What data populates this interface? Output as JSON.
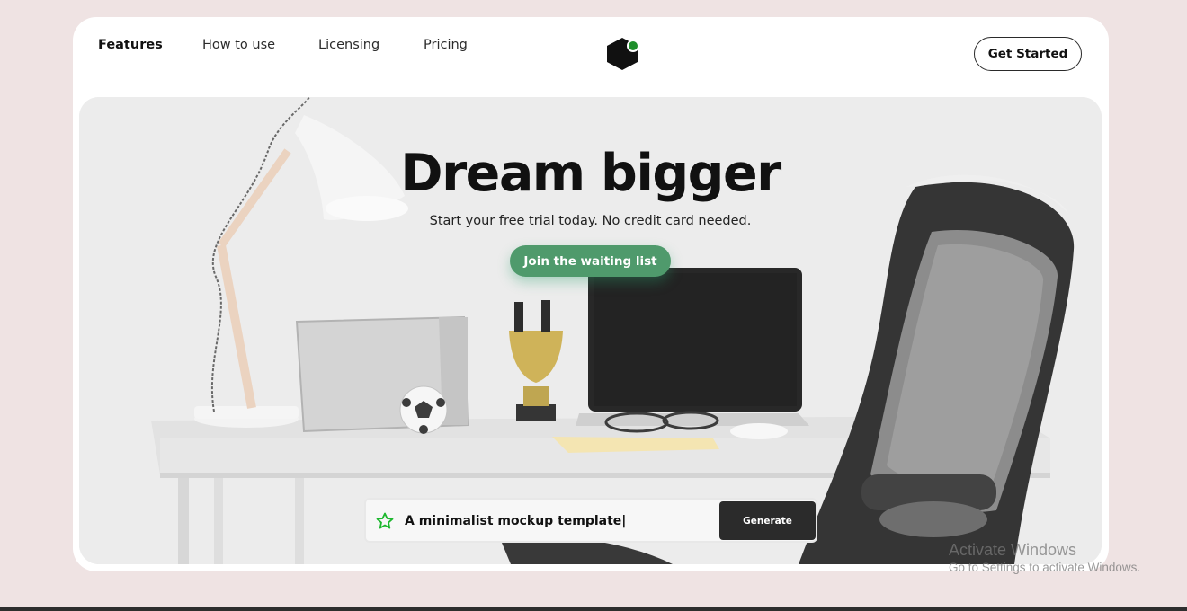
{
  "nav": {
    "items": [
      {
        "label": "Features",
        "active": true
      },
      {
        "label": "How to use",
        "active": false
      },
      {
        "label": "Licensing",
        "active": false
      },
      {
        "label": "Pricing",
        "active": false
      }
    ],
    "logo_icon": "hexagon-logo-icon",
    "cta_label": "Get Started"
  },
  "hero": {
    "title": "Dream bigger",
    "subtitle": "Start your free trial today. No credit card needed.",
    "waitlist_label": "Join the waiting list"
  },
  "generator": {
    "icon": "star-outline-icon",
    "input_value": "A minimalist mockup template|",
    "button_label": "Generate"
  },
  "watermark": {
    "line1": "Activate Windows",
    "line2": "Go to Settings to activate Windows."
  },
  "colors": {
    "page_bg": "#efe3e3",
    "accent_green": "#4f9a6c",
    "logo_dot": "#1e8f2b",
    "dark": "#2b2b2b"
  }
}
